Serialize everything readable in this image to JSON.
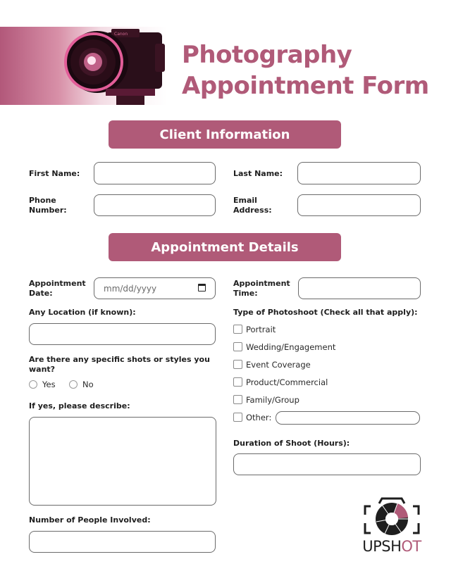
{
  "header": {
    "title_line1": "Photography",
    "title_line2": "Appointment Form",
    "image": "camera-photo"
  },
  "colors": {
    "accent": "#b05a78",
    "border": "#6b6b6b",
    "text": "#1e1e1e"
  },
  "sections": {
    "client": "Client Information",
    "appointment": "Appointment Details"
  },
  "client_fields": {
    "first_name": {
      "label": "First Name:",
      "value": ""
    },
    "last_name": {
      "label": "Last Name:",
      "value": ""
    },
    "phone_line1": "Phone",
    "phone_line2": "Number:",
    "phone_value": "",
    "email_line1": "Email",
    "email_line2": "Address:",
    "email_value": ""
  },
  "appointment_fields": {
    "date_line1": "Appointment",
    "date_line2": "Date:",
    "date_placeholder": "mm/dd/yyyy",
    "time_line1": "Appointment",
    "time_line2": "Time:",
    "location_label": "Any Location (if known):",
    "shots_question_line1": "Are there any specific shots or styles you",
    "shots_question_line2": "want?",
    "radio_options": [
      {
        "label": "Yes",
        "selected": false
      },
      {
        "label": "No",
        "selected": false
      }
    ],
    "describe_label": "If yes, please describe:",
    "people_label": "Number of People Involved:",
    "photoshoot_type_label": "Type of Photoshoot (Check all that apply):",
    "photoshoot_types": [
      {
        "label": "Portrait",
        "checked": false
      },
      {
        "label": "Wedding/Engagement",
        "checked": false
      },
      {
        "label": "Event Coverage",
        "checked": false
      },
      {
        "label": "Product/Commercial",
        "checked": false
      },
      {
        "label": "Family/Group",
        "checked": false
      },
      {
        "label": "Other:",
        "checked": false
      }
    ],
    "duration_label": "Duration of Shoot (Hours):"
  },
  "logo": {
    "text_dark": "UPSH",
    "text_accent": "OT",
    "icon": "camera-aperture-icon"
  }
}
